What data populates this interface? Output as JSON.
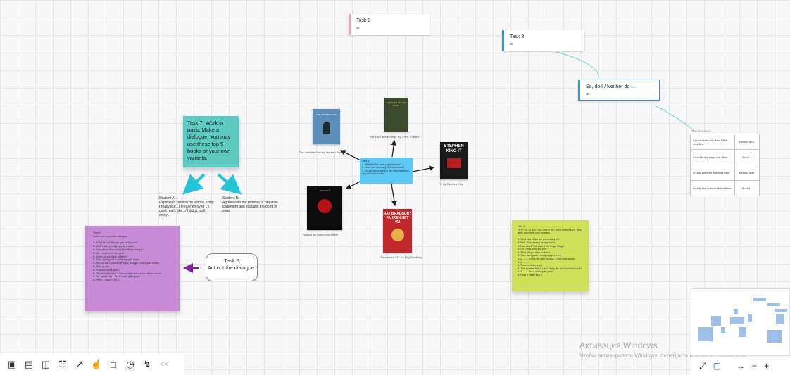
{
  "board": {
    "task2": {
      "title": "Task 2"
    },
    "task3": {
      "title": "Task 3"
    },
    "so_do_i": {
      "title": "So, do I / Neither do I."
    },
    "task7": {
      "text": "Task 7. Work in pairs. Make a dialogue. You may use these top 5 books or your own variants."
    },
    "student_a": {
      "text": "Student A:\nExpresses opinion on a book using I really like.../ I really enjoyed .../ I don't really like.../ I didn't really enjoy..."
    },
    "student_b": {
      "text": "Student B:\nAgrees with the positive or negative statement and explains the point of view."
    },
    "task6": {
      "text": "Task 6\nAct out the dialogue."
    },
    "task5": {
      "text": "Task 5\nListen and repeat the dialogue.\n\nA: What kind of film are you looking for?\nB: Well, I like reading fantasy books.\nA: How about 'The Lord of the Rings' trilogy?\nB: Oh, I read them last year.\nA: What did you think of them?\nB: They were good. I really enjoyed them.\nA: Yes, so did I. It took me ages, though. I read quite slowly.\nB: Yes, so do I.\nA: This one looks good.\nB: 'The Invisible Man'? I don't really like science fiction books.\nA: No, neither do I. But it looks quite good.\nB: Hmm. I think I'll try it."
    },
    "task4": {
      "text": "Task 4\nFill in 'So, so did I / No, neither do I' in the correct form. Then listen and check your answers.\n\nA: What kind of film are you looking for?\nB: Well, I like reading fantasy books.\nA: How about 'The Lord of the Rings' trilogy?\nB: Oh, I read them last year.\nA: What did you think of them?\nB: They were good. I really enjoyed them.\nA: 1. ........ It took me ages, though. I read quite slowly.\nB: 2. ........\nA: This one looks good.\nB: 'The Invisible Man'? I don't really like science fiction books.\nA: 3. ........ But it looks quite good.\nB: Hmm. I think I'll try it."
    },
    "task1": {
      "text": "Task 1\n1. Which is the most popular book?\n2. Have you read any of these books?\n3. Do you know if there are films based on any of these books?"
    },
    "books": [
      {
        "caption": "'The Invisible Man' by Herbert Wells",
        "cover_title": "THE INVISIBLE MAN",
        "color": "#5b8fb9"
      },
      {
        "caption": "'The Lord of the Rings' by J.R.R. Tolkien",
        "cover_title": "THE LORD OF THE RINGS",
        "color": "#3b4a2a"
      },
      {
        "caption": "'It' by Stephen King",
        "cover_title": "STEPHEN KING IT",
        "color": "#1a1a1a"
      },
      {
        "caption": "'Twilight' by Stephenie Meyer",
        "cover_title": "TWILIGHT",
        "color": "#0d0d0d"
      },
      {
        "caption": "'Fahrenheit 451' by Ray Bradbury",
        "cover_title": "RAY BRADBURY FAHRENHEIT 451",
        "color": "#c0282b"
      }
    ],
    "table": {
      "header": "Match the sentences",
      "rows": [
        [
          "I didn't really like Brad Pitt's new film.",
          "Neither do I."
        ],
        [
          "I don't really enjoy war films.",
          "So do I."
        ],
        [
          "I really enjoyed 'Mamma Mia!'",
          "Neither did I."
        ],
        [
          "I really like science fiction films.",
          "So did I."
        ]
      ]
    }
  },
  "watermark": {
    "line1": "Активация Windows",
    "line2": "Чтобы активировать Windows, перейдите в раздел \"Параметры\"."
  },
  "toolbar": {
    "icons": [
      "sticky-note-icon",
      "comment-icon",
      "card-icon",
      "template-icon",
      "share-icon",
      "like-icon",
      "video-icon",
      "timer-icon",
      "activity-icon",
      "collapse-icon"
    ],
    "collapse_label": "<<"
  },
  "zoom": {
    "fit_label": "⤢",
    "map_label": "▢",
    "fit_width_label": "↔",
    "minus_label": "−",
    "plus_label": "+"
  },
  "colors": {
    "task7": "#5ecbc3",
    "task5": "#c68ad6",
    "task4": "#cfe05b",
    "task1": "#5bc8f5",
    "task2_accent": "#f2a5b0",
    "task3_accent": "#3f8ddc"
  }
}
